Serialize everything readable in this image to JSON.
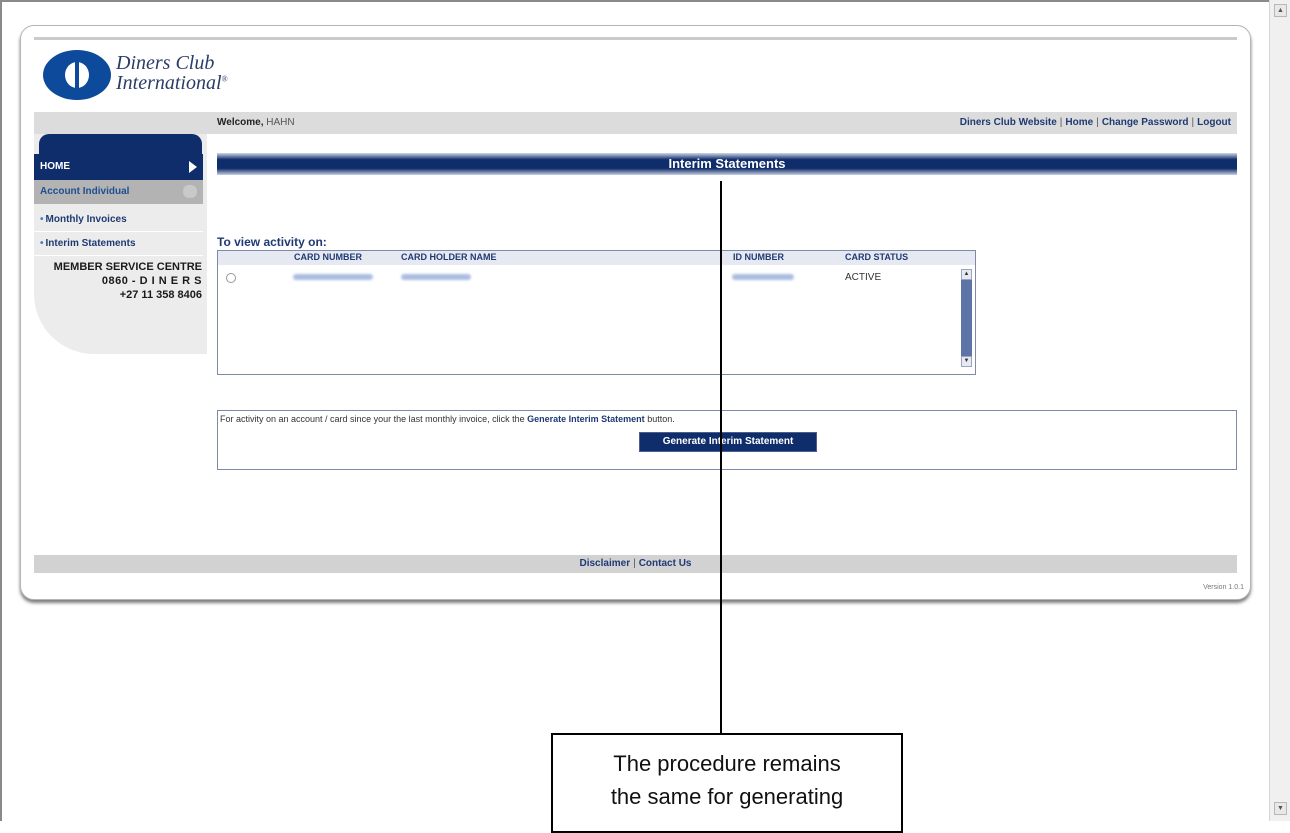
{
  "logo": {
    "line1": "Diners Club",
    "line2": "International",
    "trademark": "®"
  },
  "header": {
    "welcome_label": "Welcome,",
    "user_name": "HAHN",
    "links": [
      "Diners Club Website",
      "Home",
      "Change Password",
      "Logout"
    ],
    "separator": "|"
  },
  "sidebar": {
    "home": "HOME",
    "account_section": "Account Individual",
    "items": [
      "Monthly Invoices",
      "Interim Statements"
    ],
    "member_service": {
      "title": "MEMBER SERVICE CENTRE",
      "phone_local": "0860 - D I N E R S",
      "phone_intl": "+27 11 358 8406"
    }
  },
  "main": {
    "title": "Interim Statements",
    "view_label": "To view activity on:",
    "table": {
      "headers": [
        "CARD NUMBER",
        "CARD HOLDER NAME",
        "ID NUMBER",
        "CARD STATUS"
      ],
      "rows": [
        {
          "card_number": "",
          "holder_name": "",
          "id_number": "",
          "status": "ACTIVE"
        }
      ]
    },
    "generate": {
      "text_before": "For activity on an account / card since your the last monthly invoice, click the ",
      "text_bold": "Generate Interim Statement",
      "text_after": " button.",
      "button_label": "Generate Interim Statement"
    }
  },
  "footer": {
    "links": [
      "Disclaimer",
      "Contact Us"
    ],
    "separator": "|",
    "version": "Version 1.0.1"
  },
  "annotation": {
    "line1": "The procedure remains",
    "line2": "the same for generating"
  },
  "colors": {
    "navy": "#0f2d6b",
    "link": "#1f3a73",
    "gray_bar": "#dcdcdc",
    "brand_blue": "#0d4a9b"
  }
}
